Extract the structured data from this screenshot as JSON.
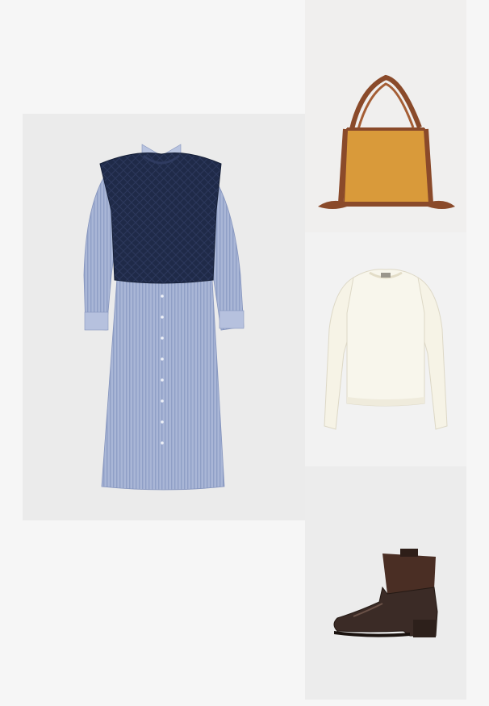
{
  "layout": {
    "panels": [
      {
        "key": "dress",
        "item": "shirt-dress-with-knit-vest",
        "alt": ""
      },
      {
        "key": "bag",
        "item": "tote-bag",
        "alt": ""
      },
      {
        "key": "sweater",
        "item": "cream-sweater",
        "alt": ""
      },
      {
        "key": "boot",
        "item": "ankle-boot",
        "alt": ""
      }
    ]
  },
  "colors": {
    "page_background": "#f6f6f6",
    "dress_panel_bg": "#ebebeb",
    "bag_panel_bg": "#f0efee",
    "sweater_panel_bg": "#f2f2f2",
    "boot_panel_bg": "#ececec",
    "shirt_blue": "#a9b6d6",
    "shirt_stripe": "#8f9fc6",
    "vest_navy": "#1f2a48",
    "bag_mustard": "#d99a3a",
    "bag_leather": "#8a4a2a",
    "sweater_cream": "#f6f3e6",
    "boot_brown": "#3b2b26",
    "boot_suede": "#4a2e24"
  }
}
